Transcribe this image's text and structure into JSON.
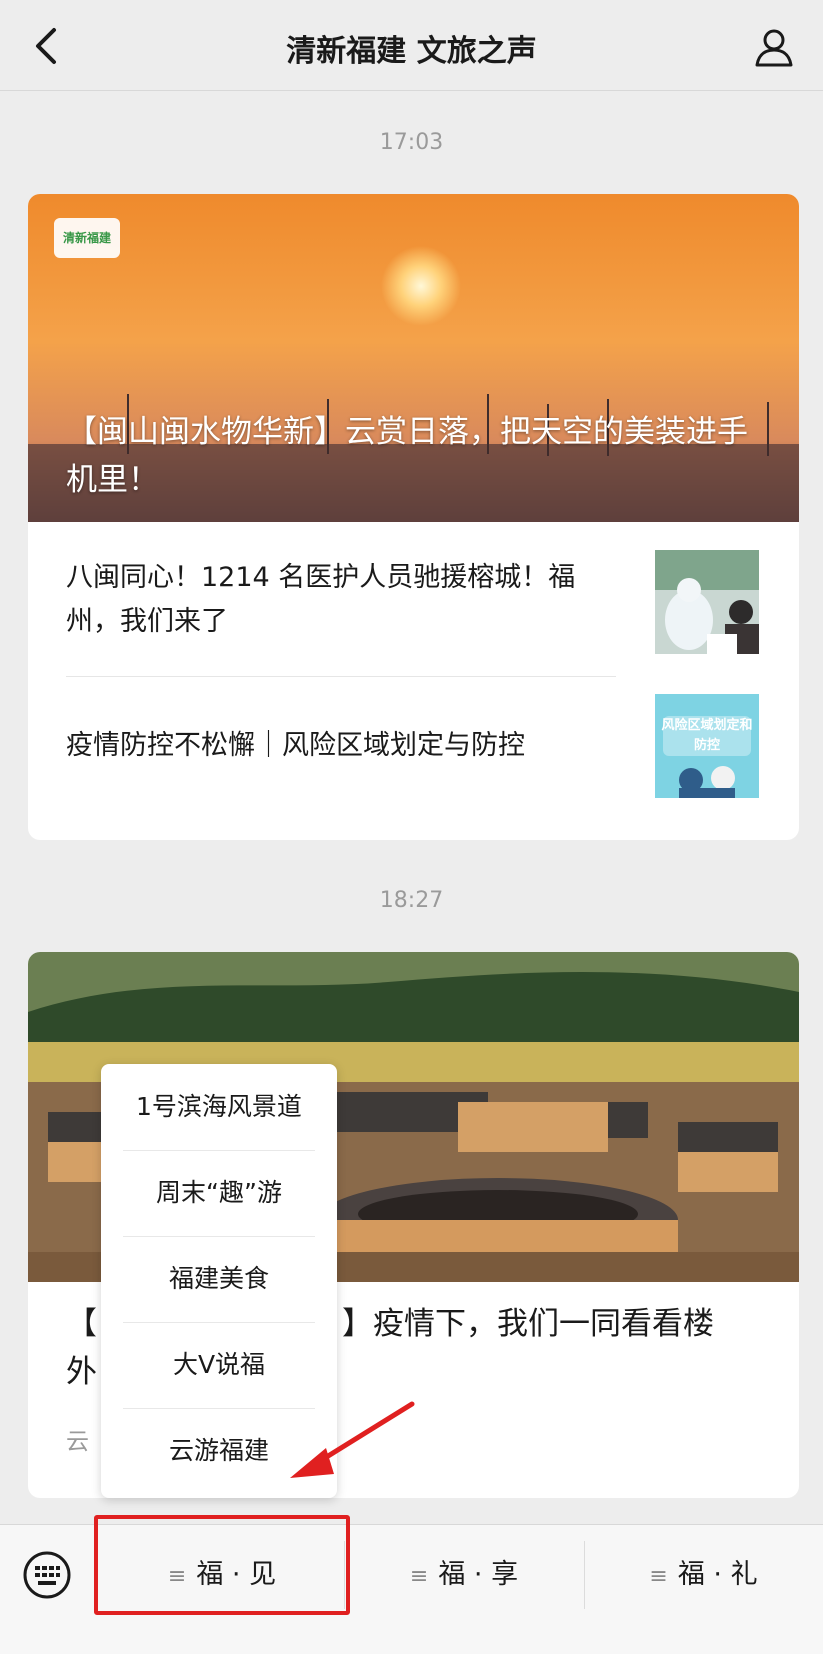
{
  "header": {
    "title": "清新福建 文旅之声"
  },
  "messages": [
    {
      "time": "17:03",
      "cover_title": "【闽山闽水物华新】云赏日落，把天空的美装进手机里！",
      "logo_text": "清新福建",
      "items": [
        {
          "title": "八闽同心！1214 名医护人员驰援榕城！福州，我们来了"
        },
        {
          "title": "疫情防控不松懈｜风险区域划定与防控",
          "thumb_text": "风险区域划定和防控"
        }
      ]
    },
    {
      "time": "18:27",
      "cover_title_visible": "【",
      "cover_title_visible_2": "】疫情下，我们一同看看楼",
      "cover_title_line2": "外",
      "source_partial": "云"
    }
  ],
  "menu": {
    "items": [
      "1号滨海风景道",
      "周末“趣”游",
      "福建美食",
      "大V说福",
      "云游福建"
    ]
  },
  "bottom_tabs": [
    "福 · 见",
    "福 · 享",
    "福 · 礼"
  ],
  "colors": {
    "highlight": "#e02020",
    "arrow": "#e02020",
    "background": "#ededed"
  }
}
